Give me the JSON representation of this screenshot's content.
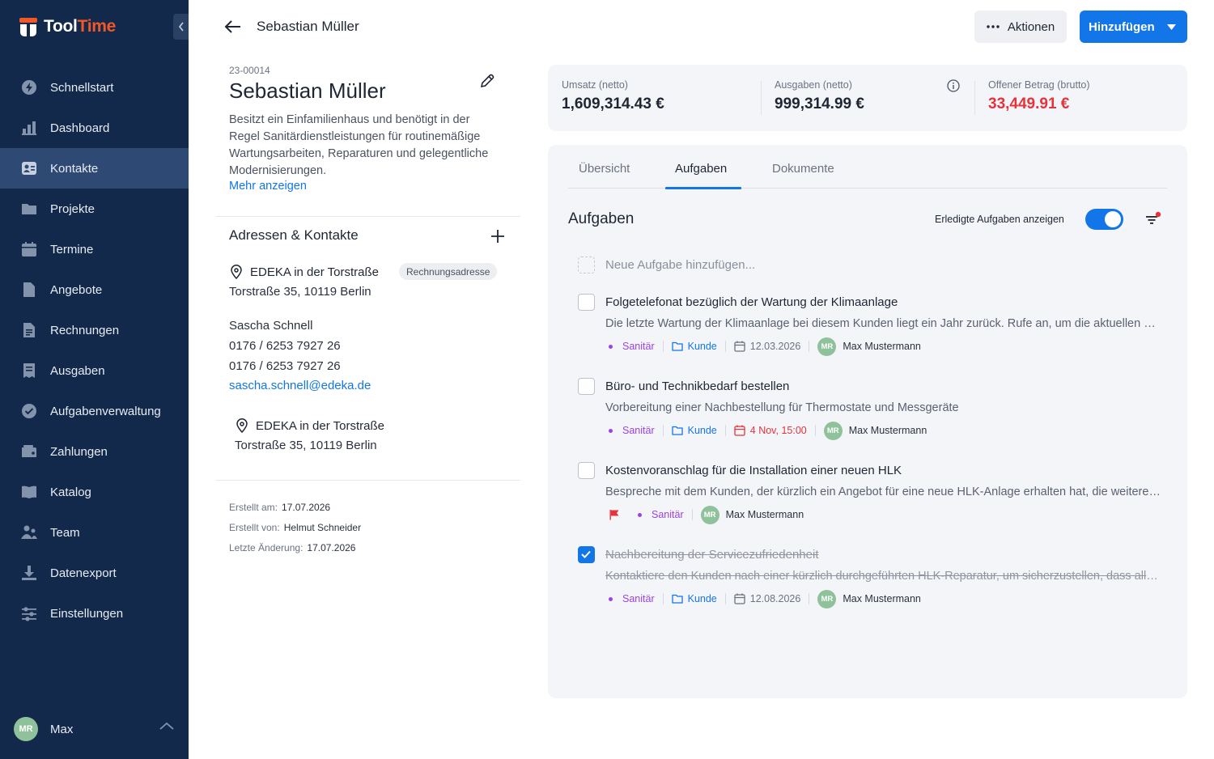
{
  "app": {
    "logo_part1": "Tool",
    "logo_part2": "Time",
    "brand_color": "#f0582a",
    "sidebar_color": "#13294b",
    "accent_color": "#1276e8"
  },
  "sidebar": {
    "items": [
      {
        "label": "Schnellstart",
        "icon": "bolt-icon"
      },
      {
        "label": "Dashboard",
        "icon": "bar-chart-icon"
      },
      {
        "label": "Kontakte",
        "icon": "contacts-icon",
        "active": true
      },
      {
        "label": "Projekte",
        "icon": "folder-icon"
      },
      {
        "label": "Termine",
        "icon": "calendar-icon"
      },
      {
        "label": "Angebote",
        "icon": "document-icon"
      },
      {
        "label": "Rechnungen",
        "icon": "invoice-icon"
      },
      {
        "label": "Ausgaben",
        "icon": "receipt-icon"
      },
      {
        "label": "Aufgabenverwaltung",
        "icon": "check-circle-icon"
      },
      {
        "label": "Zahlungen",
        "icon": "wallet-icon"
      },
      {
        "label": "Katalog",
        "icon": "book-icon"
      },
      {
        "label": "Team",
        "icon": "team-icon"
      },
      {
        "label": "Datenexport",
        "icon": "download-icon"
      },
      {
        "label": "Einstellungen",
        "icon": "sliders-icon"
      }
    ],
    "user": {
      "initials": "MR",
      "name": "Max"
    }
  },
  "header": {
    "title": "Sebastian Müller",
    "actions_label": "Aktionen",
    "add_label": "Hinzufügen"
  },
  "contact": {
    "id": "23-00014",
    "name": "Sebastian Müller",
    "description": "Besitzt ein Einfamilienhaus und benötigt in der Regel Sanitärdienstleistungen für routinemäßige Wartungsarbeiten, Reparaturen und gelegentliche Modernisierungen.",
    "more_link": "Mehr anzeigen",
    "addresses_title": "Adressen & Kontakte",
    "address1": {
      "name": "EDEKA in der Torstraße",
      "badge": "Rechnungsadresse",
      "street": "Torstraße 35, 10119 Berlin"
    },
    "person": {
      "name": "Sascha Schnell",
      "phone1": "0176 / 6253 7927 26",
      "phone2": "0176 / 6253 7927 26",
      "email": "sascha.schnell@edeka.de"
    },
    "address2": {
      "name": "EDEKA in der Torstraße",
      "street": "Torstraße 35, 10119 Berlin"
    },
    "meta": {
      "created_at_label": "Erstellt am:",
      "created_at": "17.07.2026",
      "created_by_label": "Erstellt von:",
      "created_by": "Helmut Schneider",
      "updated_label": "Letzte Änderung:",
      "updated": "17.07.2026"
    }
  },
  "stats": {
    "revenue_label": "Umsatz (netto)",
    "revenue": "1,609,314.43 €",
    "expenses_label": "Ausgaben (netto)",
    "expenses": "999,314.99 €",
    "open_label": "Offener Betrag (brutto)",
    "open": "33,449.91 €"
  },
  "tabs": [
    {
      "label": "Übersicht"
    },
    {
      "label": "Aufgaben",
      "active": true
    },
    {
      "label": "Dokumente"
    }
  ],
  "tasks": {
    "title": "Aufgaben",
    "toggle_label": "Erledigte Aufgaben anzeigen",
    "toggle_on": true,
    "new_placeholder": "Neue Aufgabe hinzufügen...",
    "items": [
      {
        "title": "Folgetelefonat bezüglich der Wartung der Klimaanlage",
        "desc": "Die letzte Wartung der Klimaanlage bei diesem Kunden liegt ein Jahr zurück. Rufe an, um die aktuellen Probleme zu besprechen.",
        "category": "Sanitär",
        "contact_tag": "Kunde",
        "date": "12.03.2026",
        "assignee_initials": "MR",
        "assignee": "Max Mustermann",
        "done": false
      },
      {
        "title": "Büro- und Technikbedarf bestellen",
        "desc": "Vorbereitung einer Nachbestellung für Thermostate und Messgeräte",
        "category": "Sanitär",
        "contact_tag": "Kunde",
        "date": "4 Nov, 15:00",
        "assignee_initials": "MR",
        "assignee": "Max Mustermann",
        "done": false
      },
      {
        "title": "Kostenvoranschlag für die Installation einer neuen HLK",
        "desc": "Bespreche mit dem Kunden, der kürzlich ein Angebot für eine neue HLK-Anlage erhalten hat, die weiteren Schritte.",
        "category": "Sanitär",
        "assignee_initials": "MR",
        "assignee": "Max Mustermann",
        "done": false
      },
      {
        "title": "Nachbereitung der Servicezufriedenheit",
        "desc": "Kontaktiere den Kunden nach einer kürzlich durchgeführten HLK-Reparatur, um sicherzustellen, dass alles funktioniert.",
        "category": "Sanitär",
        "contact_tag": "Kunde",
        "date": "12.08.2026",
        "assignee_initials": "MR",
        "assignee": "Max Mustermann",
        "done": true
      }
    ]
  }
}
